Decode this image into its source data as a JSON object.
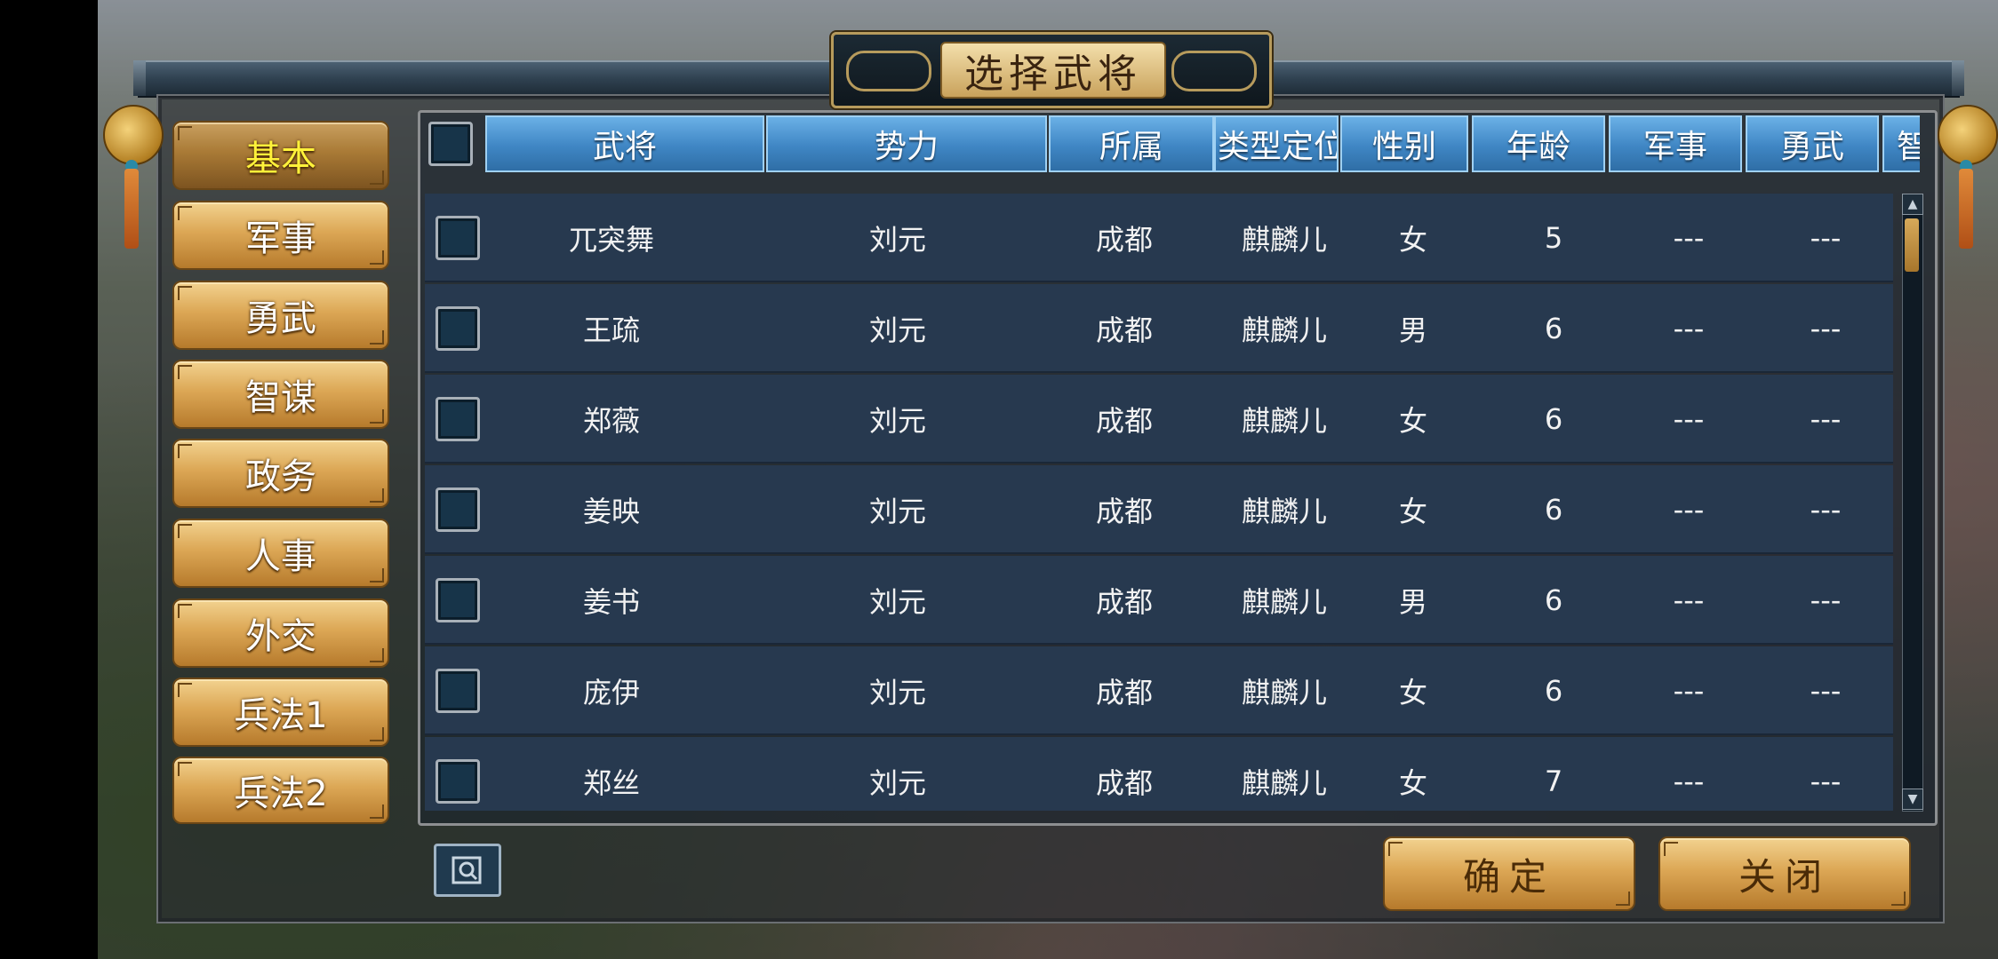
{
  "dialog": {
    "title": "选择武将"
  },
  "tabs": [
    {
      "label": "基本",
      "active": true
    },
    {
      "label": "军事",
      "active": false
    },
    {
      "label": "勇武",
      "active": false
    },
    {
      "label": "智谋",
      "active": false
    },
    {
      "label": "政务",
      "active": false
    },
    {
      "label": "人事",
      "active": false
    },
    {
      "label": "外交",
      "active": false
    },
    {
      "label": "兵法1",
      "active": false
    },
    {
      "label": "兵法2",
      "active": false
    }
  ],
  "table": {
    "headers": [
      "武将",
      "势力",
      "所属",
      "类型定位",
      "性别",
      "年龄",
      "军事",
      "勇武",
      "智"
    ],
    "rows": [
      {
        "name": "兀突舞",
        "force": "刘元",
        "city": "成都",
        "type": "麒麟儿",
        "gender": "女",
        "age": "5",
        "military": "---",
        "valor": "---"
      },
      {
        "name": "王疏",
        "force": "刘元",
        "city": "成都",
        "type": "麒麟儿",
        "gender": "男",
        "age": "6",
        "military": "---",
        "valor": "---"
      },
      {
        "name": "郑薇",
        "force": "刘元",
        "city": "成都",
        "type": "麒麟儿",
        "gender": "女",
        "age": "6",
        "military": "---",
        "valor": "---"
      },
      {
        "name": "姜映",
        "force": "刘元",
        "city": "成都",
        "type": "麒麟儿",
        "gender": "女",
        "age": "6",
        "military": "---",
        "valor": "---"
      },
      {
        "name": "姜书",
        "force": "刘元",
        "city": "成都",
        "type": "麒麟儿",
        "gender": "男",
        "age": "6",
        "military": "---",
        "valor": "---"
      },
      {
        "name": "庞伊",
        "force": "刘元",
        "city": "成都",
        "type": "麒麟儿",
        "gender": "女",
        "age": "6",
        "military": "---",
        "valor": "---"
      },
      {
        "name": "郑丝",
        "force": "刘元",
        "city": "成都",
        "type": "麒麟儿",
        "gender": "女",
        "age": "7",
        "military": "---",
        "valor": "---"
      }
    ]
  },
  "buttons": {
    "confirm": "确定",
    "close": "关闭"
  },
  "icons": {
    "search": "magnifier-icon",
    "scroll_up": "chevron-up-icon",
    "scroll_down": "chevron-down-icon"
  },
  "colors": {
    "active_tab_text": "#fff23a",
    "header_blue": "#3f86c4",
    "row_bg": "#27394f"
  }
}
